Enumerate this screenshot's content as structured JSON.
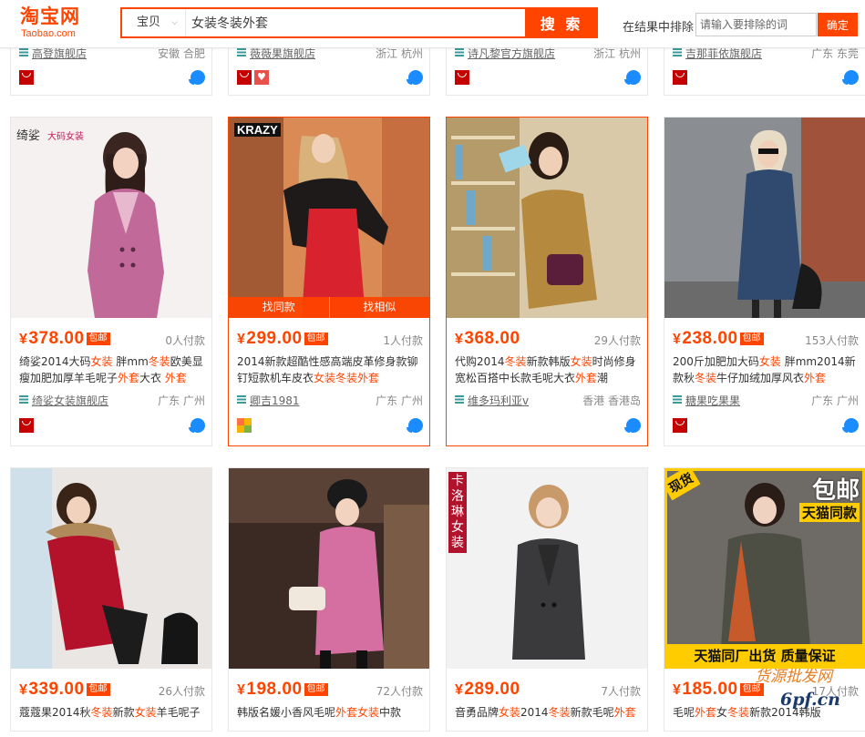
{
  "header": {
    "logo_cn": "淘宝网",
    "logo_en": "Taobao.com",
    "search_scope": "宝贝",
    "search_query": "女装冬装外套",
    "search_button": "搜 索",
    "exclude_label": "在结果中排除",
    "exclude_placeholder": "请输入要排除的词",
    "confirm_button": "确定"
  },
  "prev_row": [
    {
      "shop": "高登旗舰店",
      "location": "安徽 合肥",
      "badges": [
        "tmall"
      ]
    },
    {
      "shop": "薇薇果旗舰店",
      "location": "浙江 杭州",
      "badges": [
        "tmall",
        "heart"
      ]
    },
    {
      "shop": "诗凡黎官方旗舰店",
      "location": "浙江 杭州",
      "badges": [
        "tmall"
      ]
    },
    {
      "shop": "吉那菲依旗舰店",
      "location": "广东 东莞",
      "badges": [
        "tmall"
      ]
    }
  ],
  "products": [
    {
      "price": "378.00",
      "free_shipping": "包邮",
      "sold": "0人付款",
      "title_parts": [
        [
          "绮娑2014大码",
          0
        ],
        [
          "女装",
          1
        ],
        [
          " 胖mm",
          0
        ],
        [
          "冬装",
          1
        ],
        [
          "欧美显瘦加肥加厚羊毛呢子",
          0
        ],
        [
          "外套",
          1
        ],
        [
          "大衣 ",
          0
        ],
        [
          "外套",
          1
        ]
      ],
      "shop": "绮娑女装旗舰店",
      "location": "广东 广州",
      "badges": [
        "tmall"
      ],
      "brand_label": "绮娑",
      "brand_tag": "大码女装"
    },
    {
      "price": "299.00",
      "free_shipping": "包邮",
      "sold": "1人付款",
      "title_parts": [
        [
          "2014新款超酷性感高端皮革修身款铆钉短款机车皮衣",
          0
        ],
        [
          "女装冬装外套",
          1
        ]
      ],
      "shop": "卿吉1981",
      "location": "广东 广州",
      "badges": [
        "grid"
      ],
      "brand_label": "KRAZY",
      "hover": true,
      "hover_left": "找同款",
      "hover_right": "找相似"
    },
    {
      "price": "368.00",
      "free_shipping": "",
      "sold": "29人付款",
      "title_parts": [
        [
          "代购2014",
          0
        ],
        [
          "冬装",
          1
        ],
        [
          "新款韩版",
          0
        ],
        [
          "女装",
          1
        ],
        [
          "时尚修身宽松百搭中长款毛呢大衣",
          0
        ],
        [
          "外套",
          1
        ],
        [
          "潮",
          0
        ]
      ],
      "shop": "维多玛利亚v",
      "location": "香港 香港岛",
      "badges": []
    },
    {
      "price": "238.00",
      "free_shipping": "包邮",
      "sold": "153人付款",
      "title_parts": [
        [
          "200斤加肥加大码",
          0
        ],
        [
          "女装",
          1
        ],
        [
          " 胖mm2014新款秋",
          0
        ],
        [
          "冬装",
          1
        ],
        [
          "牛仔加绒加厚风衣",
          0
        ],
        [
          "外套",
          1
        ]
      ],
      "shop": "糖果吃果果",
      "location": "广东 广州",
      "badges": [
        "tmall"
      ]
    },
    {
      "price": "339.00",
      "free_shipping": "包邮",
      "sold": "26人付款",
      "title_parts": [
        [
          "蔻蔻果2014秋",
          0
        ],
        [
          "冬装",
          1
        ],
        [
          "新款",
          0
        ],
        [
          "女装",
          1
        ],
        [
          "羊毛呢子",
          0
        ]
      ]
    },
    {
      "price": "198.00",
      "free_shipping": "包邮",
      "sold": "72人付款",
      "title_parts": [
        [
          "韩版名媛小香风毛呢",
          0
        ],
        [
          "外套女装",
          1
        ],
        [
          "中款",
          0
        ]
      ]
    },
    {
      "price": "289.00",
      "free_shipping": "",
      "sold": "7人付款",
      "title_parts": [
        [
          "音勇品牌",
          0
        ],
        [
          "女装",
          1
        ],
        [
          "2014",
          0
        ],
        [
          "冬装",
          1
        ],
        [
          "新款毛呢",
          0
        ],
        [
          "外套",
          1
        ]
      ],
      "brand_label": "卡洛琳女装"
    },
    {
      "price": "185.00",
      "free_shipping": "包邮",
      "sold": "17人付款",
      "title_parts": [
        [
          "毛呢",
          0
        ],
        [
          "外套",
          1
        ],
        [
          "女",
          0
        ],
        [
          "冬装",
          1
        ],
        [
          "新款2014韩版",
          0
        ]
      ],
      "brand_label": "现货",
      "promo_top": "包邮",
      "promo_sub": "天猫同款",
      "promo_bottom": "天猫同厂出货 质量保证"
    }
  ],
  "watermark": "货源批发网 6pf.cn"
}
